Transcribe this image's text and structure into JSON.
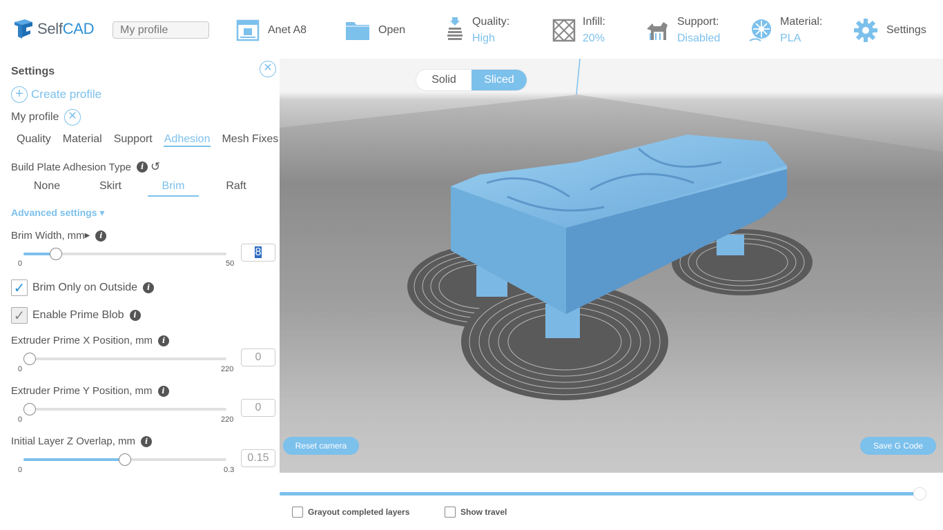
{
  "header": {
    "logo": {
      "part1": "Self",
      "part2": "CAD"
    },
    "profile_placeholder": "My profile",
    "printer": "Anet A8",
    "open": "Open",
    "quality": {
      "label": "Quality:",
      "value": "High"
    },
    "infill": {
      "label": "Infill:",
      "value": "20%"
    },
    "support": {
      "label": "Support:",
      "value": "Disabled"
    },
    "material": {
      "label": "Material:",
      "value": "PLA"
    },
    "settings": "Settings"
  },
  "panel": {
    "title": "Settings",
    "create_profile": "Create profile",
    "profile_name": "My profile",
    "tabs": [
      "Quality",
      "Material",
      "Support",
      "Adhesion",
      "Mesh Fixes"
    ],
    "active_tab": "Adhesion",
    "adhesion_type": {
      "label": "Build Plate Adhesion Type",
      "options": [
        "None",
        "Skirt",
        "Brim",
        "Raft"
      ],
      "selected": "Brim"
    },
    "advanced_label": "Advanced settings",
    "brim_width": {
      "label": "Brim Width, mm",
      "min": "0",
      "max": "50",
      "value": "8",
      "fraction": 0.16
    },
    "brim_outside": {
      "label": "Brim Only on Outside",
      "checked": true
    },
    "prime_blob": {
      "label": "Enable Prime Blob",
      "checked": true,
      "disabled": true
    },
    "prime_x": {
      "label": "Extruder Prime X Position, mm",
      "min": "0",
      "max": "220",
      "value": "0",
      "fraction": 0.03
    },
    "prime_y": {
      "label": "Extruder Prime Y Position, mm",
      "min": "0",
      "max": "220",
      "value": "0",
      "fraction": 0.03
    },
    "z_overlap": {
      "label": "Initial Layer Z Overlap, mm",
      "min": "0",
      "max": "0.3",
      "value": "0.15",
      "fraction": 0.5
    }
  },
  "viewport": {
    "view_modes": [
      "Solid",
      "Sliced"
    ],
    "active_mode": "Sliced",
    "reset_camera": "Reset camera",
    "save_gcode": "Save G Code"
  },
  "bottom": {
    "layer_fraction": 1.0,
    "grayout": "Grayout completed layers",
    "show_travel": "Show travel"
  },
  "colors": {
    "accent": "#7cc0ec",
    "model": "#77b3e0",
    "brim": "#4a4a4a"
  }
}
